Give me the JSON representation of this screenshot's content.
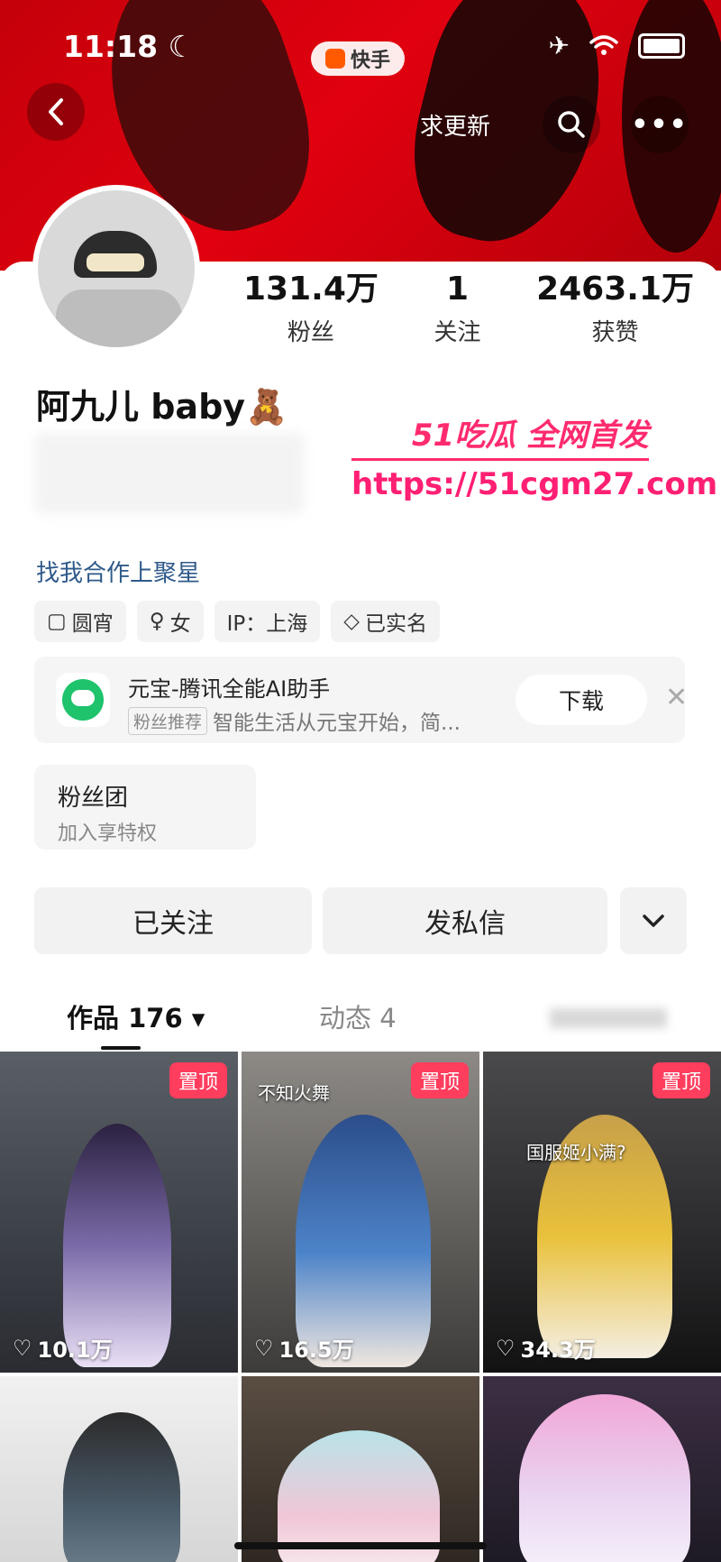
{
  "status": {
    "time": "11:18",
    "app_name": "快手"
  },
  "header": {
    "update_label": "求更新"
  },
  "stats": [
    {
      "num": "131.4万",
      "label": "粉丝"
    },
    {
      "num": "1",
      "label": "关注"
    },
    {
      "num": "2463.1万",
      "label": "获赞"
    }
  ],
  "profile": {
    "name": "阿九儿 baby🧸",
    "collab_link": "找我合作上聚星"
  },
  "watermark": {
    "top": "51吃瓜 全网首发",
    "url": "https://51cgm27.com"
  },
  "tags": [
    {
      "icon": "▢",
      "label": "圆宵"
    },
    {
      "icon": "♀",
      "label": "女"
    },
    {
      "icon": "",
      "label": "IP：上海"
    },
    {
      "icon": "◇",
      "label": "已实名"
    }
  ],
  "ad": {
    "title": "元宝-腾讯全能AI助手",
    "badge": "粉丝推荐",
    "desc": "智能生活从元宝开始，简...",
    "download": "下载"
  },
  "fanclub": {
    "title": "粉丝团",
    "subtitle": "加入享特权"
  },
  "actions": {
    "followed": "已关注",
    "message": "发私信",
    "more": "⌄"
  },
  "tabs": {
    "works": "作品 176 ▾",
    "moments": "动态 4"
  },
  "grid": [
    {
      "pin": "置顶",
      "likes": "10.1万",
      "caption": ""
    },
    {
      "pin": "置顶",
      "likes": "16.5万",
      "caption": "不知火舞"
    },
    {
      "pin": "置顶",
      "likes": "34.3万",
      "caption": "国服姬小满?"
    },
    {
      "pin": "",
      "likes": "",
      "caption": ""
    },
    {
      "pin": "",
      "likes": "",
      "caption": ""
    },
    {
      "pin": "",
      "likes": "",
      "caption": ""
    }
  ],
  "colors": {
    "accent": "#ff3d5d",
    "link": "#2f5a8a",
    "header": "#d7000d"
  }
}
